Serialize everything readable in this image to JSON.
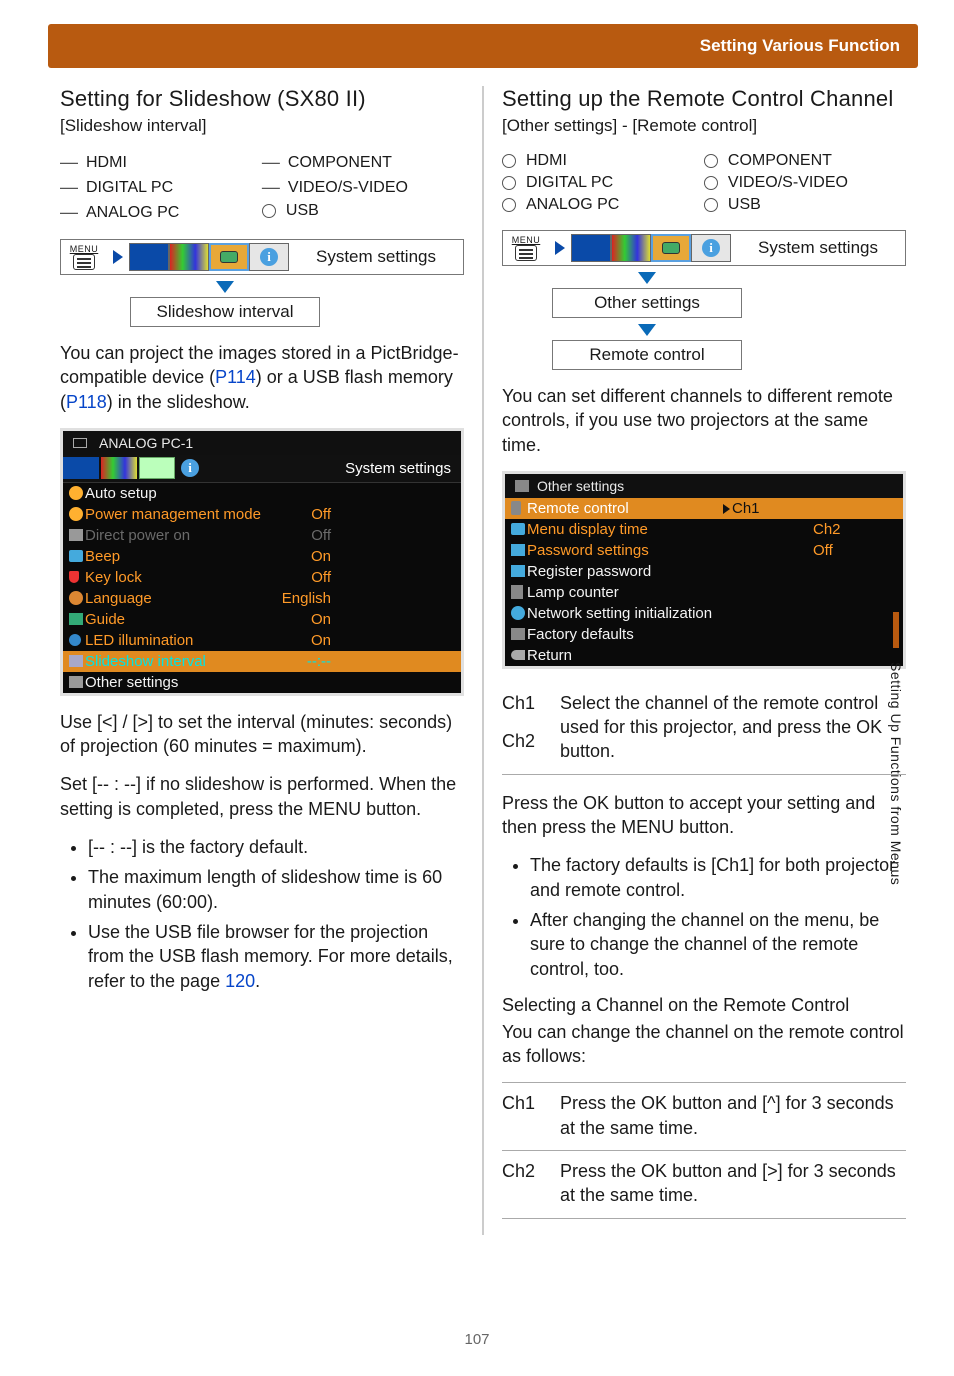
{
  "header": {
    "title": "Setting Various Function"
  },
  "side_tab": "Setting Up Functions from Menus",
  "page_number": "107",
  "left": {
    "h2": "Setting for Slideshow (SX80 II)",
    "sub": "[Slideshow interval]",
    "inputs_a": [
      "HDMI",
      "DIGITAL PC",
      "ANALOG PC"
    ],
    "inputs_b": [
      "COMPONENT",
      "VIDEO/S-VIDEO",
      "USB"
    ],
    "nav_label": "System settings",
    "drop": "Slideshow interval",
    "para1a": "You can project the images stored in a PictBridge-compatible device (",
    "link1": "P114",
    "para1b": ") or a USB flash memory (",
    "link2": "P118",
    "para1c": ") in the slideshow.",
    "ms_title": "ANALOG PC-1",
    "ms_tab_title": "System settings",
    "ms_rows": [
      {
        "label": "Auto setup",
        "val": "",
        "cls": "white",
        "ico": "ia"
      },
      {
        "label": "Power management mode",
        "val": "Off",
        "cls": "",
        "ico": "ia"
      },
      {
        "label": "Direct power on",
        "val": "Off",
        "cls": "dim",
        "ico": "ih"
      },
      {
        "label": "Beep",
        "val": "On",
        "cls": "",
        "ico": "ib"
      },
      {
        "label": "Key lock",
        "val": "Off",
        "cls": "",
        "ico": "ic"
      },
      {
        "label": "Language",
        "val": "English",
        "cls": "",
        "ico": "id"
      },
      {
        "label": "Guide",
        "val": "On",
        "cls": "",
        "ico": "ie"
      },
      {
        "label": "LED illumination",
        "val": "On",
        "cls": "",
        "ico": "if"
      },
      {
        "label": "Slideshow interval",
        "val": "--:--",
        "cls": "sel",
        "ico": "ig"
      },
      {
        "label": "Other settings",
        "val": "",
        "cls": "white",
        "ico": "ih"
      }
    ],
    "para2": "Use [<] / [>] to set the interval (minutes: seconds) of projection (60 minutes = maximum).",
    "para3": "Set [-- : --] if no slideshow is performed. When the setting is completed, press the ",
    "para3b": " button.",
    "menu_word": "MENU",
    "bullets": [
      {
        "pre": "[-- : --] is the factory default."
      },
      {
        "pre": "The maximum length of slideshow time is 60 minutes (60:00)."
      },
      {
        "pre": "Use the USB file browser for the projection from the USB flash memory. For more details, refer to the page ",
        "link": "120",
        "post": "."
      }
    ]
  },
  "right": {
    "h2": "Setting up the Remote Control Channel",
    "sub": "[Other settings] - [Remote control]",
    "inputs_a": [
      "HDMI",
      "DIGITAL PC",
      "ANALOG PC"
    ],
    "inputs_b": [
      "COMPONENT",
      "VIDEO/S-VIDEO",
      "USB"
    ],
    "nav_label": "System settings",
    "drop1": "Other settings",
    "drop2": "Remote control",
    "para1": "You can set different channels to different remote controls, if you use two projectors at the same time.",
    "ms_title": "Other settings",
    "ms_rows": [
      {
        "label": "Remote control",
        "ch1": "Ch1",
        "ch2": "",
        "cls": "sel",
        "ico": "rc"
      },
      {
        "label": "Menu display time",
        "ch1": "",
        "ch2": "Ch2",
        "cls": "",
        "ico": "ib"
      },
      {
        "label": "Password settings",
        "ch1": "",
        "ch2": "Off",
        "cls": "",
        "ico": "pw"
      },
      {
        "label": "Register password",
        "ch1": "",
        "ch2": "",
        "cls": "white",
        "ico": "pw"
      },
      {
        "label": "Lamp counter",
        "ch1": "",
        "ch2": "",
        "cls": "white",
        "ico": "lamp"
      },
      {
        "label": "Network setting initialization",
        "ch1": "",
        "ch2": "",
        "cls": "white",
        "ico": "net"
      },
      {
        "label": "Factory defaults",
        "ch1": "",
        "ch2": "",
        "cls": "white",
        "ico": "fd"
      },
      {
        "label": "Return",
        "ch1": "",
        "ch2": "",
        "cls": "white",
        "ico": "ret"
      }
    ],
    "ch_table1": [
      {
        "lbl": "Ch1",
        "txt_a": "Select the channel of the remote control used for this projector, and press the ",
        "ok": "OK",
        "txt_b": " button.",
        "lbl2": "Ch2"
      }
    ],
    "para2a": "Press the ",
    "ok": "OK",
    "para2b": " button to accept your setting and then press the ",
    "menu": "MENU",
    "para2c": " button.",
    "bullets": [
      "The factory defaults is [Ch1] for both projector and remote control.",
      "After changing the channel on the menu, be sure to change the channel of the remote control, too."
    ],
    "subh": "Selecting a Channel on the Remote Control",
    "para3": "You can change the channel on the remote control as follows:",
    "ch_table2": [
      {
        "lbl": "Ch1",
        "a": "Press the ",
        "ok": "OK",
        "b": " button and [^] for 3 seconds at the same time."
      },
      {
        "lbl": "Ch2",
        "a": "Press the ",
        "ok": "OK",
        "b": " button and [>] for 3 seconds at the same time."
      }
    ]
  }
}
